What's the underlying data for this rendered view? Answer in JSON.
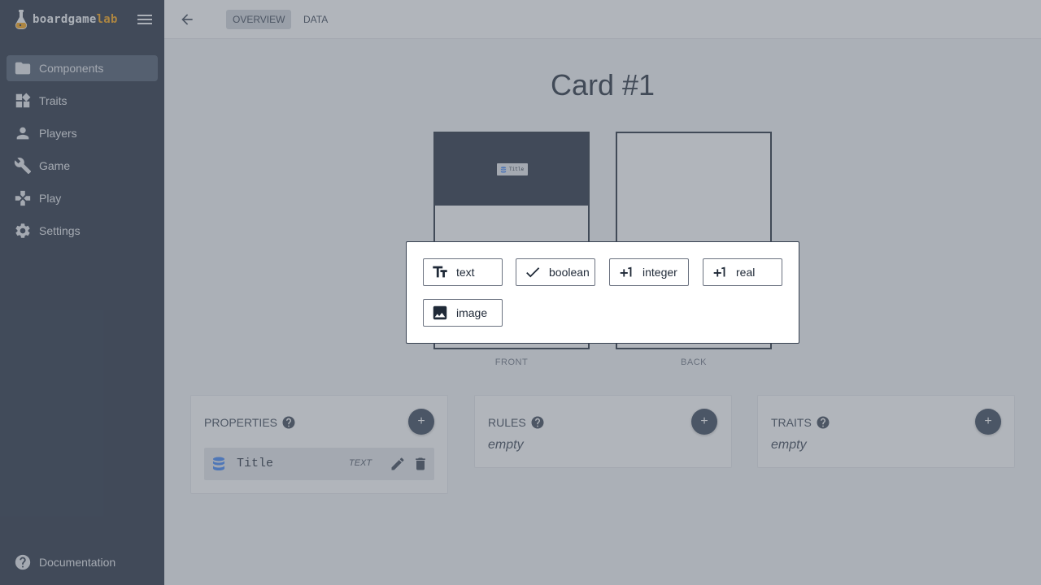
{
  "brand": {
    "name_part1": "boardgame",
    "name_part2": "lab",
    "accent": "#f59e0b"
  },
  "sidebar": {
    "items": [
      {
        "label": "Components",
        "icon": "folder-icon",
        "active": true
      },
      {
        "label": "Traits",
        "icon": "widgets-icon"
      },
      {
        "label": "Players",
        "icon": "person-icon"
      },
      {
        "label": "Game",
        "icon": "wrench-icon"
      },
      {
        "label": "Play",
        "icon": "gamepad-icon"
      },
      {
        "label": "Settings",
        "icon": "gear-icon"
      }
    ],
    "footer": {
      "label": "Documentation",
      "icon": "help-icon"
    }
  },
  "topbar": {
    "tabs": [
      {
        "label": "OVERVIEW",
        "active": true
      },
      {
        "label": "DATA"
      }
    ]
  },
  "card": {
    "title": "Card #1",
    "front_label": "FRONT",
    "back_label": "BACK",
    "front_chip": "Title"
  },
  "panels": {
    "properties": {
      "title": "PROPERTIES",
      "add": "+",
      "items": [
        {
          "name": "Title",
          "type": "TEXT"
        }
      ]
    },
    "rules": {
      "title": "RULES",
      "add": "+",
      "empty": "empty"
    },
    "traits": {
      "title": "TRAITS",
      "add": "+",
      "empty": "empty"
    }
  },
  "popup": {
    "types": [
      {
        "label": "text",
        "icon": "text-format-icon"
      },
      {
        "label": "boolean",
        "icon": "check-icon"
      },
      {
        "label": "integer",
        "icon": "plus-one-icon"
      },
      {
        "label": "real",
        "icon": "plus-one-icon"
      },
      {
        "label": "image",
        "icon": "image-icon"
      }
    ]
  }
}
